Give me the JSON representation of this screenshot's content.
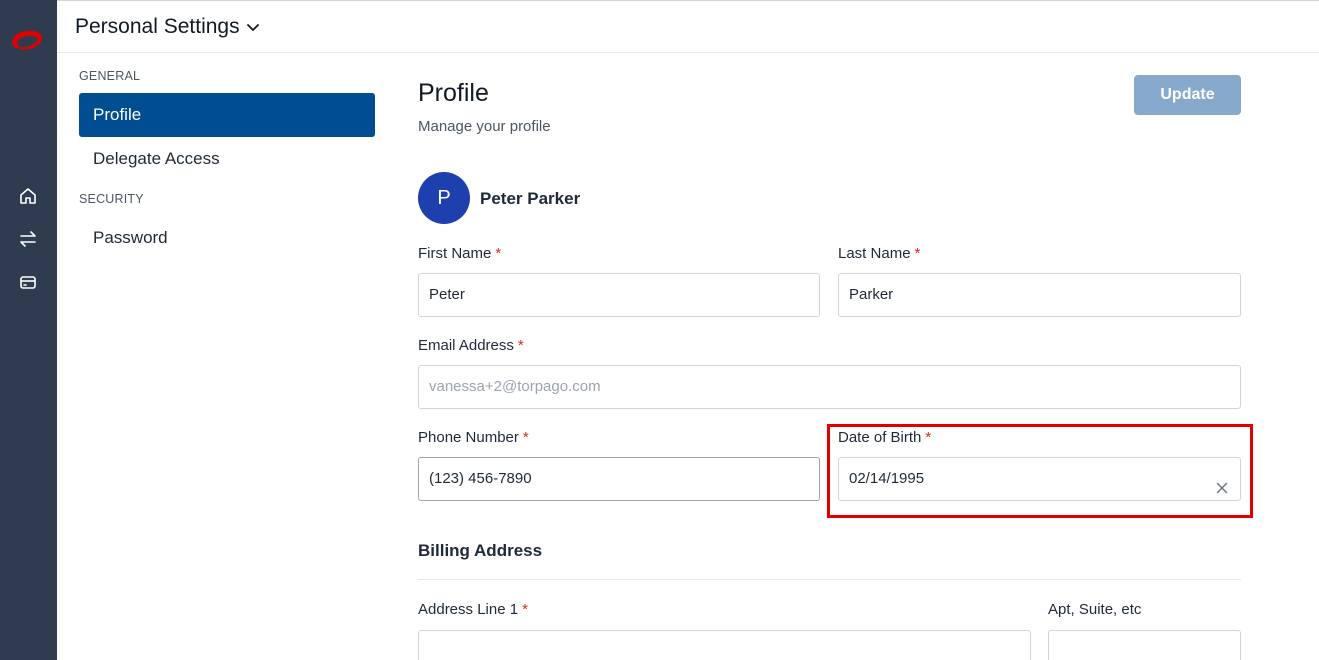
{
  "app": {
    "header_title": "Personal Settings",
    "brand_color": "#e00000",
    "accent_color": "#004d91"
  },
  "rail": {
    "icons": [
      "home-icon",
      "transfer-icon",
      "card-icon"
    ]
  },
  "sidebar": {
    "sections": [
      {
        "label": "GENERAL",
        "items": [
          {
            "label": "Profile",
            "active": true
          },
          {
            "label": "Delegate Access",
            "active": false
          }
        ]
      },
      {
        "label": "SECURITY",
        "items": [
          {
            "label": "Password",
            "active": false
          }
        ]
      }
    ]
  },
  "profile": {
    "title": "Profile",
    "subtitle": "Manage your profile",
    "update_label": "Update",
    "avatar_initial": "P",
    "user_name": "Peter Parker"
  },
  "form": {
    "required_mark": "*",
    "first_name": {
      "label": "First Name",
      "value": "Peter"
    },
    "last_name": {
      "label": "Last Name",
      "value": "Parker"
    },
    "email": {
      "label": "Email Address",
      "placeholder": "vanessa+2@torpago.com"
    },
    "phone": {
      "label": "Phone Number",
      "value": "(123) 456-7890"
    },
    "dob": {
      "label": "Date of Birth",
      "value": "02/14/1995"
    },
    "billing_title": "Billing Address",
    "address1": {
      "label": "Address Line 1"
    },
    "apt": {
      "label": "Apt, Suite, etc"
    }
  }
}
